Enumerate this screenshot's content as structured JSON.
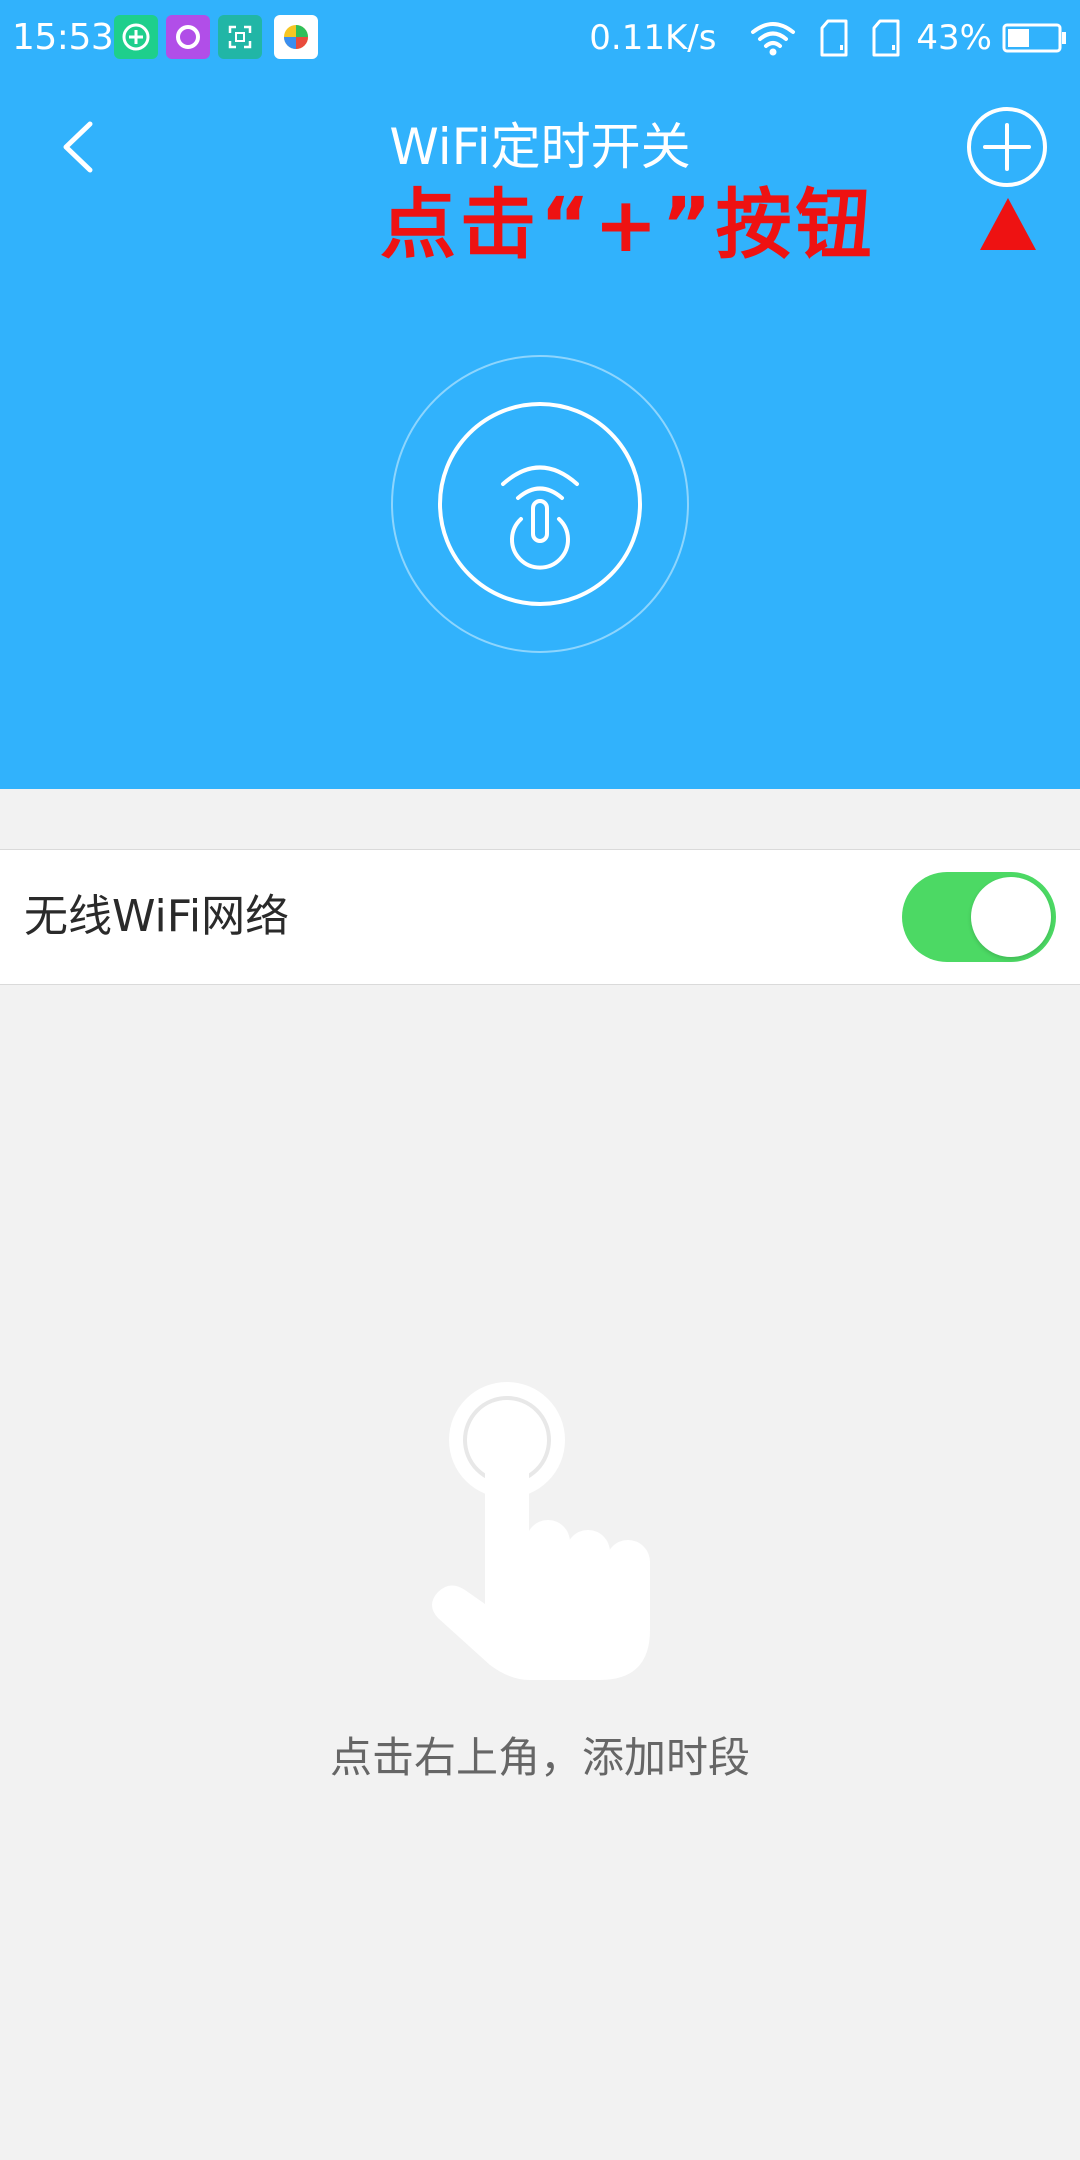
{
  "status_bar": {
    "time": "15:53",
    "notification_icons": [
      {
        "name": "add-circle-app-icon",
        "color": "#1ecf8c"
      },
      {
        "name": "circle-app-icon",
        "color": "#b14ee8"
      },
      {
        "name": "scan-app-icon",
        "color": "#21b6a6"
      },
      {
        "name": "colorful-app-icon",
        "color": "#ffffff"
      }
    ],
    "network_speed": "0.11K/s",
    "battery_percent": "43%",
    "battery_level": 0.43
  },
  "header": {
    "title": "WiFi定时开关",
    "background_color": "#31b2fc"
  },
  "annotation": {
    "text": "点击“+”按钮",
    "color": "#ee1212"
  },
  "settings": {
    "wifi_label": "无线WiFi网络",
    "wifi_enabled": true,
    "toggle_color": "#4cd964"
  },
  "empty_state": {
    "message": "点击右上角，添加时段"
  }
}
